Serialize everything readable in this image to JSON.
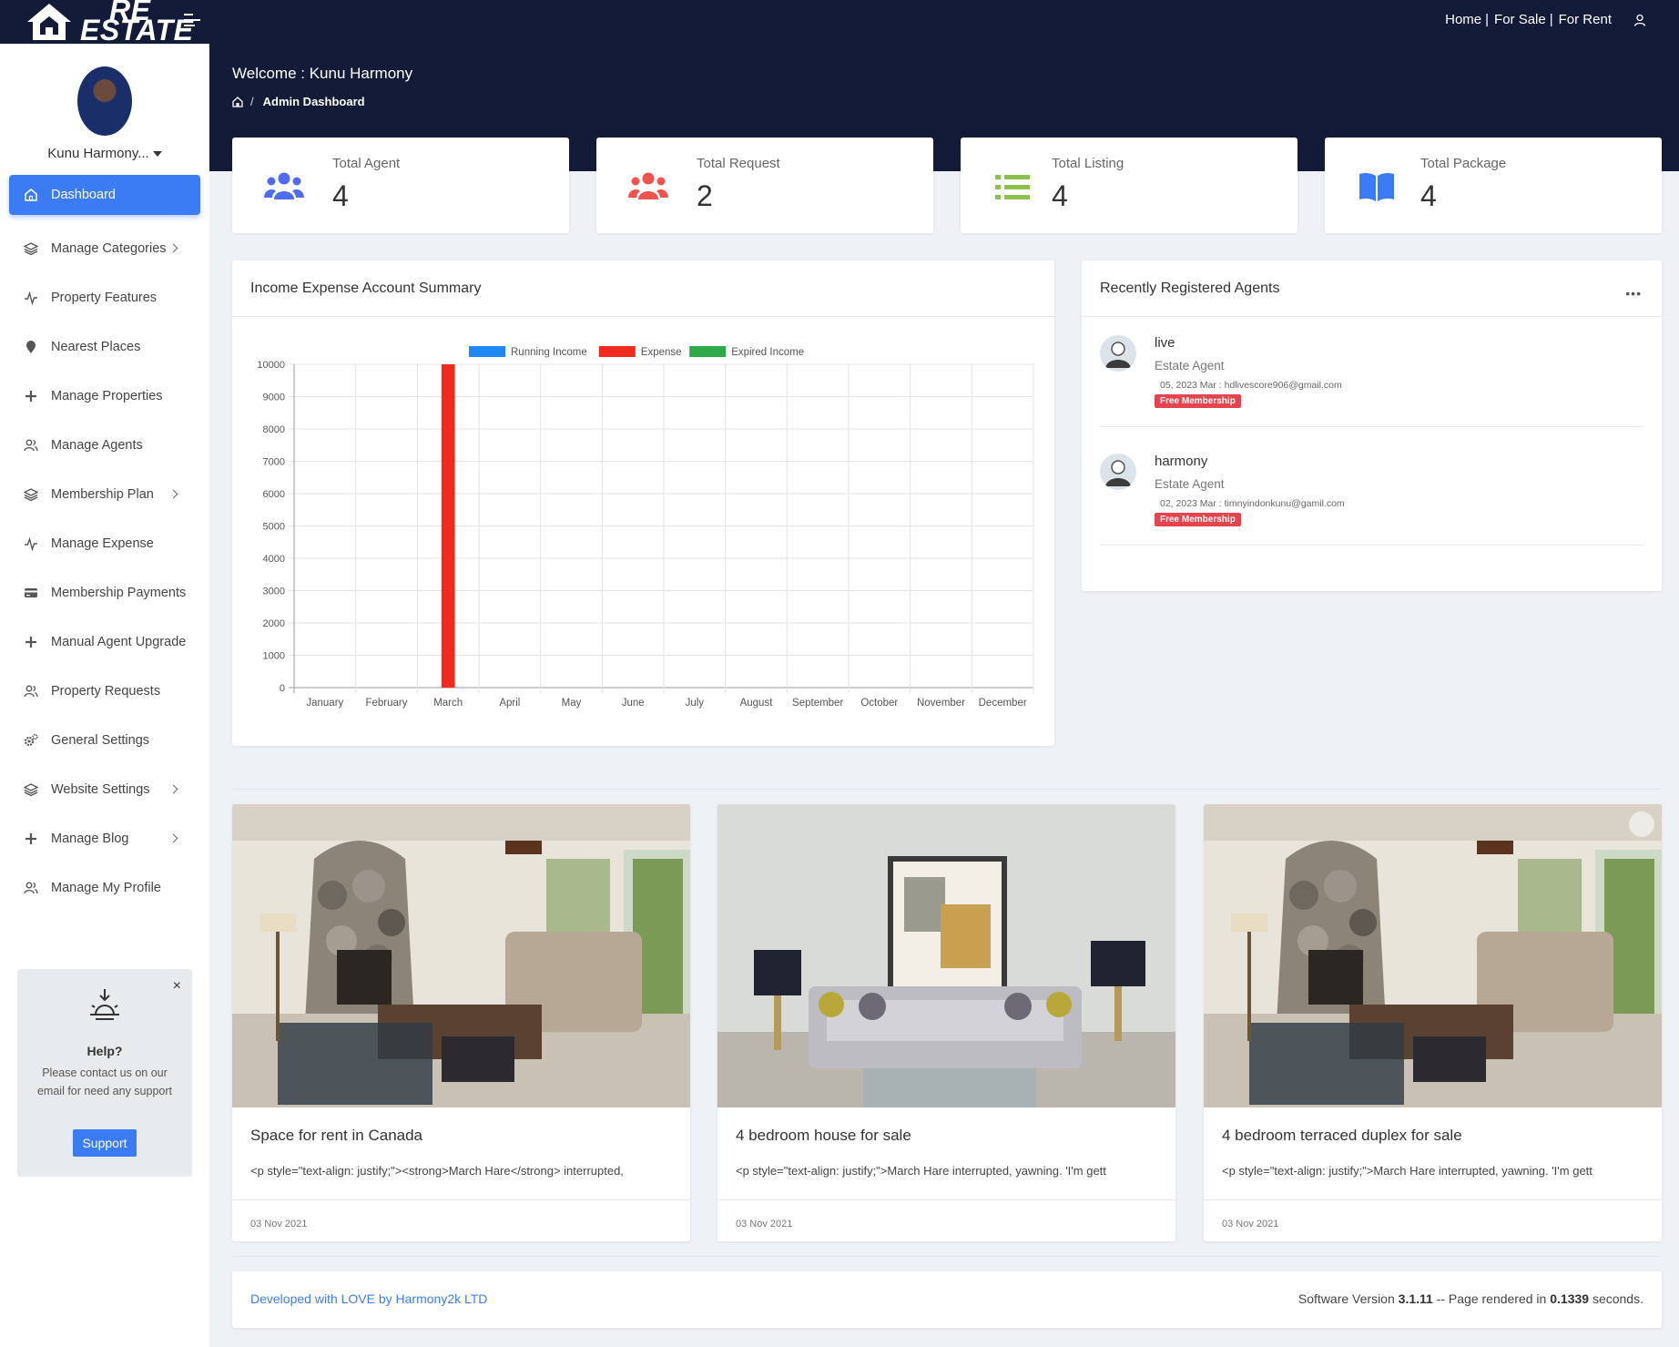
{
  "header": {
    "brand_top": "RE",
    "brand_bottom": "ESTATE",
    "nav": [
      "Home",
      "For Sale",
      "For Rent"
    ],
    "welcome": "Welcome : Kunu Harmony",
    "breadcrumb": "Admin Dashboard"
  },
  "sidebar": {
    "user_name": "Kunu Harmony...",
    "items": [
      {
        "label": "Dashboard",
        "icon": "home-icon",
        "active": true
      },
      {
        "label": "Manage Categories",
        "icon": "layers-icon",
        "chevron": true
      },
      {
        "label": "Property Features",
        "icon": "activity-icon"
      },
      {
        "label": "Nearest Places",
        "icon": "map-pin-icon"
      },
      {
        "label": "Manage Properties",
        "icon": "plus-icon"
      },
      {
        "label": "Manage Agents",
        "icon": "users-icon"
      },
      {
        "label": "Membership Plan",
        "icon": "layers-icon",
        "chevron": true
      },
      {
        "label": "Manage Expense",
        "icon": "activity-icon"
      },
      {
        "label": "Membership Payments",
        "icon": "credit-card-icon"
      },
      {
        "label": "Manual Agent Upgrade",
        "icon": "plus-icon"
      },
      {
        "label": "Property Requests",
        "icon": "users-icon"
      },
      {
        "label": "General Settings",
        "icon": "gears-icon"
      },
      {
        "label": "Website Settings",
        "icon": "layers-icon",
        "chevron": true
      },
      {
        "label": "Manage Blog",
        "icon": "plus-icon",
        "chevron": true
      },
      {
        "label": "Manage My Profile",
        "icon": "users-icon"
      }
    ],
    "help": {
      "title": "Help?",
      "text": "Please contact us on our email for need any support",
      "button": "Support",
      "close": "×"
    }
  },
  "stats": [
    {
      "label": "Total Agent",
      "value": "4",
      "icon": "users-icon",
      "color": "#4f6cf0"
    },
    {
      "label": "Total Request",
      "value": "2",
      "icon": "users-icon",
      "color": "#f0524f"
    },
    {
      "label": "Total Listing",
      "value": "4",
      "icon": "list-icon",
      "color": "#8bc34a"
    },
    {
      "label": "Total Package",
      "value": "4",
      "icon": "book-icon",
      "color": "#3b7cf5"
    }
  ],
  "chart_card": {
    "title": "Income Expense Account Summary"
  },
  "chart_data": {
    "type": "bar",
    "categories": [
      "January",
      "February",
      "March",
      "April",
      "May",
      "June",
      "July",
      "August",
      "September",
      "October",
      "November",
      "December"
    ],
    "series": [
      {
        "name": "Running Income",
        "color": "#1e88f5",
        "values": [
          0,
          0,
          0,
          0,
          0,
          0,
          0,
          0,
          0,
          0,
          0,
          0
        ]
      },
      {
        "name": "Expense",
        "color": "#f02a1e",
        "values": [
          0,
          0,
          10000,
          0,
          0,
          0,
          0,
          0,
          0,
          0,
          0,
          0
        ]
      },
      {
        "name": "Expired Income",
        "color": "#2eaa48",
        "values": [
          0,
          0,
          0,
          0,
          0,
          0,
          0,
          0,
          0,
          0,
          0,
          0
        ]
      }
    ],
    "ylim": [
      0,
      10000
    ],
    "yticks": [
      0,
      1000,
      2000,
      3000,
      4000,
      5000,
      6000,
      7000,
      8000,
      9000,
      10000
    ],
    "legend": "top",
    "grid": true
  },
  "agents_card": {
    "title": "Recently Registered Agents",
    "menu": "•••",
    "agents": [
      {
        "name": "live",
        "role": "Estate Agent",
        "meta": "05, 2023 Mar : hdlivescore906@gmail.com",
        "badge": "Free Membership"
      },
      {
        "name": "harmony",
        "role": "Estate Agent",
        "meta": "02, 2023 Mar : timnyindonkunu@gamil.com",
        "badge": "Free Membership"
      }
    ]
  },
  "properties": [
    {
      "title": "Space for rent in Canada",
      "desc": "<p style=\"text-align: justify;\"><strong>March Hare</strong> interrupted,",
      "date": "03 Nov 2021"
    },
    {
      "title": "4 bedroom house for sale",
      "desc": "<p style=\"text-align: justify;\">March Hare interrupted, yawning. 'I'm gett",
      "date": "03 Nov 2021"
    },
    {
      "title": "4 bedroom terraced duplex for sale",
      "desc": "<p style=\"text-align: justify;\">March Hare interrupted, yawning. 'I'm gett",
      "date": "03 Nov 2021"
    }
  ],
  "footer": {
    "developed": "Developed with LOVE by Harmony2k LTD",
    "version_prefix": "Software Version",
    "version": "3.1.11",
    "render_prefix": "--  Page rendered in",
    "render_time": "0.1339",
    "render_suffix": "seconds."
  }
}
